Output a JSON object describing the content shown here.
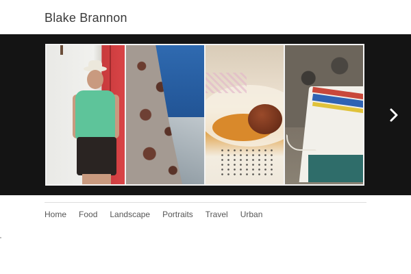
{
  "site": {
    "title": "Blake Brannon"
  },
  "gallery": {
    "photos": [
      {
        "subject": "portrait"
      },
      {
        "subject": "landscape"
      },
      {
        "subject": "food"
      },
      {
        "subject": "boat"
      }
    ],
    "next_icon": "chevron-right-icon"
  },
  "nav": {
    "items": [
      {
        "label": "Home"
      },
      {
        "label": "Food"
      },
      {
        "label": "Landscape"
      },
      {
        "label": "Portraits"
      },
      {
        "label": "Travel"
      },
      {
        "label": "Urban"
      }
    ]
  },
  "colors": {
    "slider_bg": "#141414",
    "title_text": "#3a3a3a",
    "nav_text": "#555555"
  }
}
